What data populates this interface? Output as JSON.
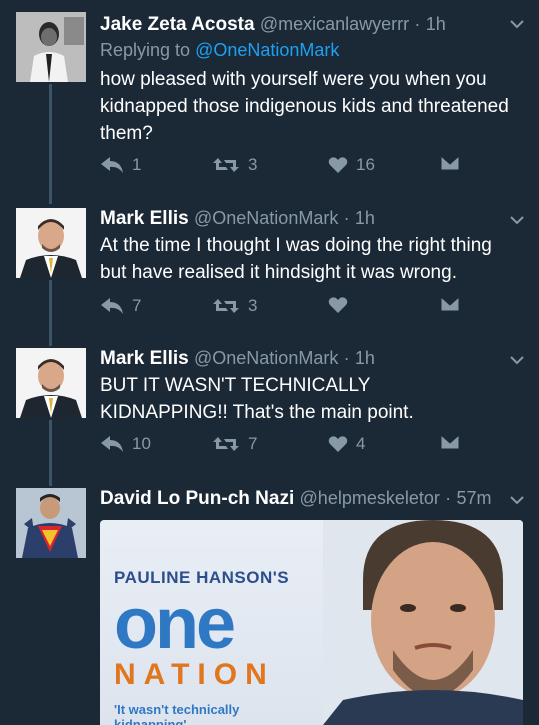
{
  "tweets": [
    {
      "name": "Jake Zeta Acosta",
      "handle": "@mexicanlawyerrr",
      "dot": "·",
      "time": "1h",
      "replying_prefix": "Replying to",
      "replying_to": "@OneNationMark",
      "text": "how pleased with yourself were you when you kidnapped those indigenous kids and threatened them?",
      "replies": "1",
      "retweets": "3",
      "likes": "16",
      "avatar_icon": "bw-portrait-avatar"
    },
    {
      "name": "Mark Ellis",
      "handle": "@OneNationMark",
      "dot": "·",
      "time": "1h",
      "text": "At the time I thought I was doing the right thing but have realised it hindsight it was wrong.",
      "replies": "7",
      "retweets": "3",
      "likes": "",
      "avatar_icon": "suit-man-avatar"
    },
    {
      "name": "Mark Ellis",
      "handle": "@OneNationMark",
      "dot": "·",
      "time": "1h",
      "text": "BUT IT WASN'T TECHNICALLY KIDNAPPING!! That's the main point.",
      "replies": "10",
      "retweets": "7",
      "likes": "4",
      "avatar_icon": "suit-man-avatar"
    },
    {
      "name": "David Lo Pun-ch Nazi",
      "handle": "@helpmeskeletor",
      "dot": "·",
      "time": "57m",
      "avatar_icon": "superhero-avatar",
      "media": {
        "top": "PAULINE HANSON'S",
        "one": "one",
        "nation": "NATION",
        "quote": "'It wasn't technically kidnapping'"
      }
    }
  ],
  "icons": {
    "reply": "reply-icon",
    "retweet": "retweet-icon",
    "like": "heart-icon",
    "dm": "envelope-icon",
    "more": "chevron-down-icon"
  },
  "colors": {
    "background": "#1b2836",
    "secondary_text": "#8899a6",
    "link": "#1da1f2",
    "thread_line": "#3d5466",
    "one_nation_blue": "#2f78c4",
    "one_nation_orange": "#e0761e"
  }
}
